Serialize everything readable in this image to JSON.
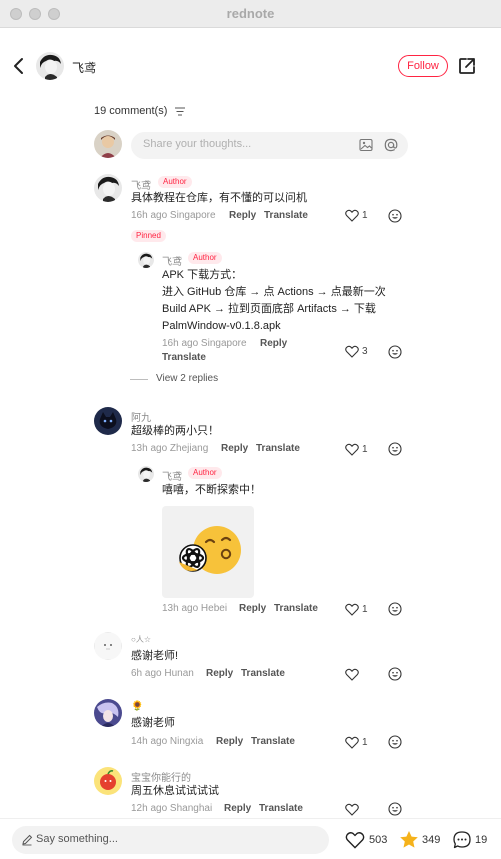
{
  "window": {
    "title": "rednote"
  },
  "header": {
    "author_name": "飞鸢",
    "follow_label": "Follow"
  },
  "comments_header": {
    "count_label": "19 comment(s)"
  },
  "input": {
    "placeholder": "Share your thoughts..."
  },
  "labels": {
    "author": "Author",
    "pinned": "Pinned",
    "reply": "Reply",
    "translate": "Translate"
  },
  "comments": [
    {
      "name": "飞鸢",
      "text": "具体教程在仓库，有不懂的可以问机",
      "meta": "16h ago Singapore",
      "likes": "1",
      "reply": {
        "name": "飞鸢",
        "lines": [
          "APK 下载方式：",
          "进入 GitHub 仓库 → 点 Actions → 点最新一次",
          "Build APK → 拉到页面底部 Artifacts → 下载",
          "PalmWindow-v0.1.8.apk"
        ],
        "meta": "16h ago Singapore",
        "likes": "3"
      },
      "view_replies": "View 2 replies"
    },
    {
      "name": "阿九",
      "text": "超级棒的两小只！",
      "meta": "13h ago Zhejiang",
      "likes": "1",
      "reply": {
        "name": "飞鸢",
        "text": "嘻嘻，不断探索中！",
        "meta": "13h ago Hebei",
        "likes": "1"
      }
    },
    {
      "name": "○人☆",
      "text": "感谢老师!",
      "meta": "6h ago Hunan",
      "likes": ""
    },
    {
      "name": "🌻",
      "text": "感谢老师",
      "meta": "14h ago Ningxia",
      "likes": "1"
    },
    {
      "name": "宝宝你能行的",
      "text": "周五休息试试试试",
      "meta": "12h ago Shanghai",
      "likes": ""
    }
  ],
  "bottom_bar": {
    "placeholder": "Say something...",
    "likes": "503",
    "stars": "349",
    "comments": "19"
  },
  "colors": {
    "accent": "#ff2442",
    "star": "#f5b21b"
  }
}
